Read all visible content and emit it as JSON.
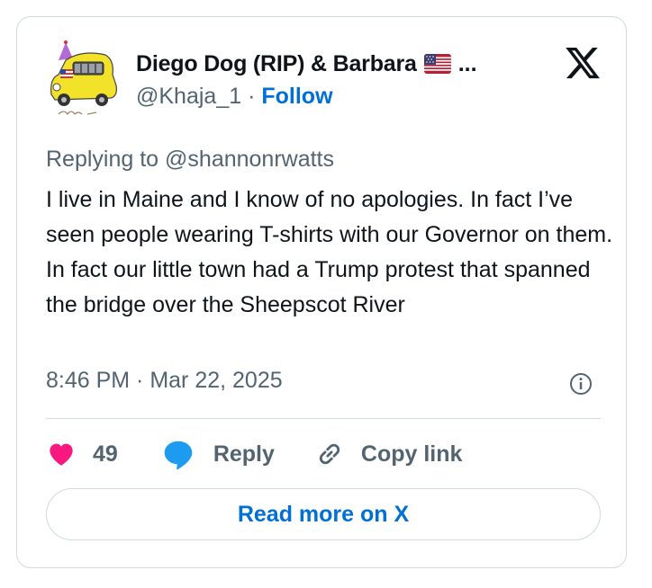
{
  "tweet": {
    "author_name": "Diego Dog (RIP) & Barbara",
    "name_truncation": "...",
    "flag_icon": "us-flag-icon",
    "handle": "@Khaja_1",
    "separator": "·",
    "follow_label": "Follow",
    "replying_prefix": "Replying to",
    "replying_to": "@shannonrwatts",
    "text": "I live in Maine and I know of no apologies. In fact I’ve seen people wearing T-shirts with our Governor on them. In fact our little town had a Trump protest that spanned the bridge over the Sheepscot River",
    "time": "8:46 PM · Mar 22, 2025"
  },
  "actions": {
    "like_count": "49",
    "reply_label": "Reply",
    "copy_label": "Copy link"
  },
  "read_more_label": "Read more on X",
  "colors": {
    "link": "#006fd6",
    "like": "#f91880",
    "reply": "#1d9bf0",
    "muted": "#536471",
    "border": "#cfd9de"
  }
}
